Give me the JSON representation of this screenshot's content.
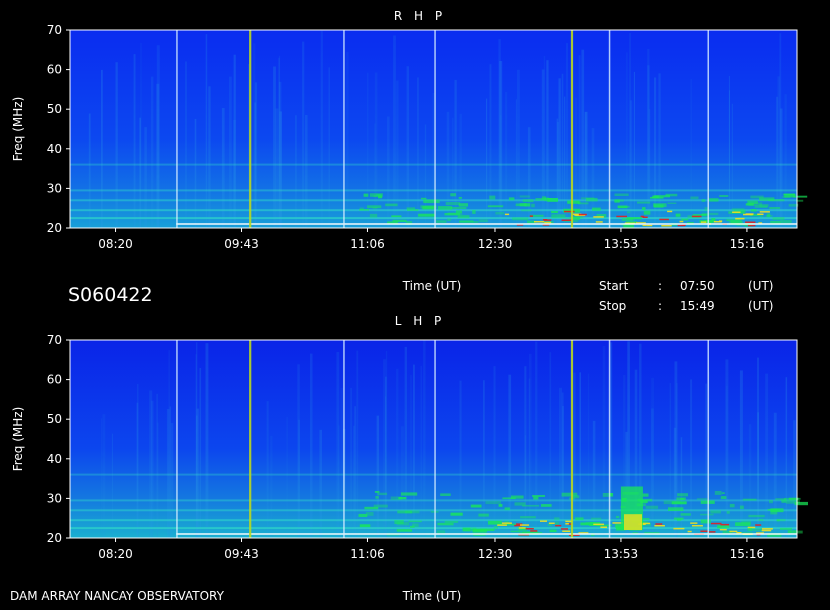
{
  "observation_id": "S060422",
  "footer_label": "DAM ARRAY   NANCAY OBSERVATORY",
  "time_axis_label": "Time (UT)",
  "start": {
    "label": "Start",
    "sep": ":",
    "time": "07:50",
    "unit": "(UT)"
  },
  "stop": {
    "label": "Stop",
    "sep": ":",
    "time": "15:49",
    "unit": "(UT)"
  },
  "chart_data": [
    {
      "type": "heatmap",
      "title": "R H P",
      "ylabel": "Freq (MHz)",
      "xlabel": "Time (UT)",
      "y_ticks": [
        "20",
        "30",
        "40",
        "50",
        "60",
        "70"
      ],
      "ylim": [
        20,
        70
      ],
      "x_ticks": [
        "08:20",
        "09:43",
        "11:06",
        "12:30",
        "13:53",
        "15:16"
      ],
      "x_range": [
        "07:50",
        "15:49"
      ],
      "colors": {
        "background": "#0a3cf0",
        "emission": "#18e858",
        "strong": "#f0e020",
        "peak": "#e02020"
      }
    },
    {
      "type": "heatmap",
      "title": "L H P",
      "ylabel": "Freq (MHz)",
      "xlabel": "Time (UT)",
      "y_ticks": [
        "20",
        "30",
        "40",
        "50",
        "60",
        "70"
      ],
      "ylim": [
        20,
        70
      ],
      "x_ticks": [
        "08:20",
        "09:43",
        "11:06",
        "12:30",
        "13:53",
        "15:16"
      ],
      "x_range": [
        "07:50",
        "15:49"
      ],
      "colors": {
        "background": "#0a3cf0",
        "emission": "#18e858",
        "strong": "#f0e020",
        "peak": "#e02020"
      }
    }
  ]
}
